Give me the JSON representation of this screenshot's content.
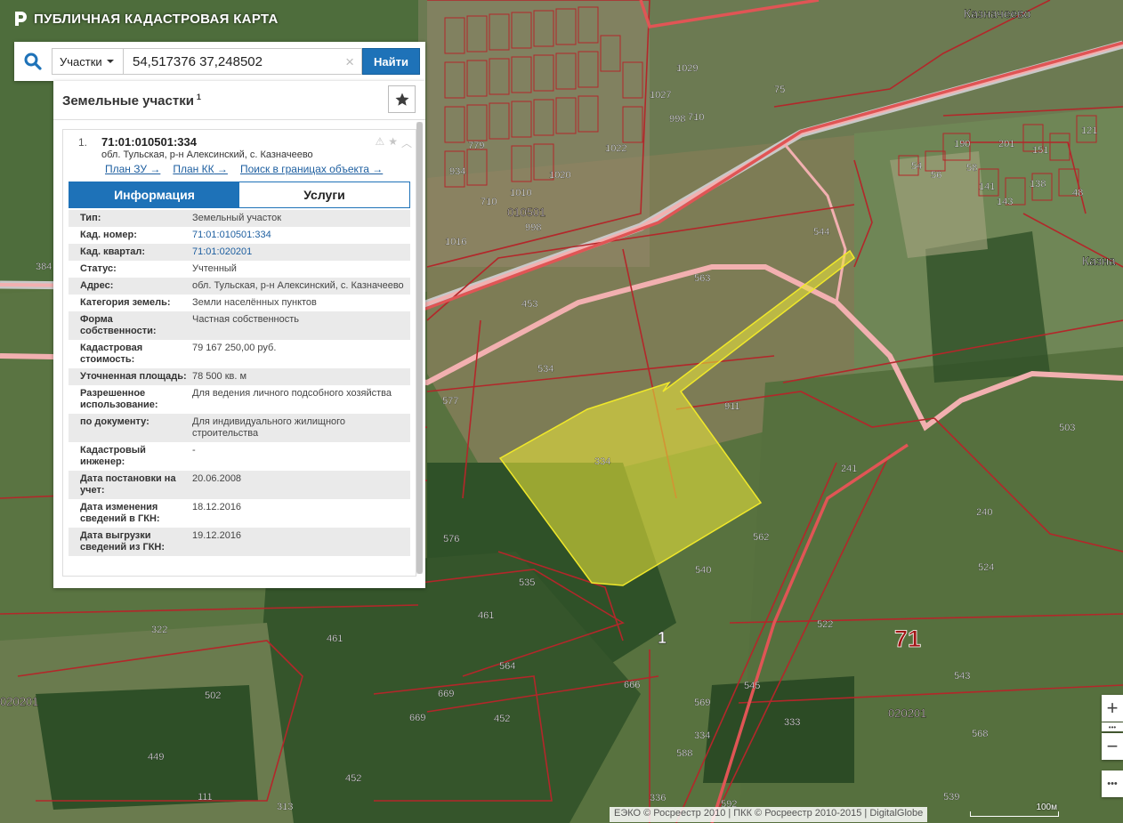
{
  "app": {
    "title": "ПУБЛИЧНАЯ КАДАСТРОВАЯ КАРТА"
  },
  "search": {
    "type_label": "Участки",
    "query": "54,517376 37,248502",
    "find_label": "Найти"
  },
  "panel": {
    "title": "Земельные участки",
    "count": "1",
    "item": {
      "index": "1.",
      "code": "71:01:010501:334",
      "address": "обл. Тульская, р-н Алексинский, с. Казначеево",
      "links": [
        "План ЗУ",
        "План КК",
        "Поиск в границах объекта"
      ],
      "tabs": [
        "Информация",
        "Услуги"
      ],
      "properties": [
        {
          "k": "Тип:",
          "v": "Земельный участок"
        },
        {
          "k": "Кад. номер:",
          "v": "71:01:010501:334",
          "link": true
        },
        {
          "k": "Кад. квартал:",
          "v": "71:01:020201",
          "link": true
        },
        {
          "k": "Статус:",
          "v": "Учтенный"
        },
        {
          "k": "Адрес:",
          "v": "обл. Тульская, р-н Алексинский, с. Казначеево"
        },
        {
          "k": "Категория земель:",
          "v": "Земли населённых пунктов"
        },
        {
          "k": "Форма собственности:",
          "v": "Частная собственность"
        },
        {
          "k": "Кадастровая стоимость:",
          "v": "79 167 250,00 руб."
        },
        {
          "k": "Уточненная площадь:",
          "v": "78 500 кв. м"
        },
        {
          "k": "Разрешенное использование:",
          "v": "Для ведения личного подсобного хозяйства"
        },
        {
          "k": "по документу:",
          "v": "Для индивидуального жилищного строительства"
        },
        {
          "k": "Кадастровый инженер:",
          "v": "-"
        },
        {
          "k": "Дата постановки на учет:",
          "v": "20.06.2008"
        },
        {
          "k": "Дата изменения сведений в ГКН:",
          "v": "18.12.2016"
        },
        {
          "k": "Дата выгрузки сведений из ГКН:",
          "v": "19.12.2016"
        }
      ]
    }
  },
  "map": {
    "places": [
      "Казначеево",
      "Казна"
    ],
    "big_labels": [
      "71",
      "1"
    ],
    "quarter_labels": [
      "010501",
      "020201",
      "020201"
    ],
    "parcel_labels": [
      "544",
      "563",
      "453",
      "534",
      "577",
      "911",
      "503",
      "240",
      "524",
      "562",
      "540",
      "522",
      "543",
      "545",
      "576",
      "535",
      "461",
      "564",
      "666",
      "669",
      "452",
      "449",
      "502",
      "322",
      "461",
      "111",
      "152",
      "313",
      "336",
      "452",
      "588",
      "569",
      "333",
      "334",
      "592",
      "568",
      "539",
      "241",
      "998",
      "1010",
      "1020",
      "1022",
      "1027",
      "1029",
      "710",
      "998",
      "384",
      "75",
      "190",
      "201",
      "151",
      "54",
      "56",
      "58",
      "148",
      "141",
      "143",
      "138",
      "48",
      "121",
      "334"
    ],
    "highlighted_parcel": "334",
    "colors": {
      "parcel_border": "#b3272a",
      "road": "#f3b3b3",
      "highlight": "#e8e33a"
    }
  },
  "controls": {
    "zoom_in": "+",
    "zoom_out": "−",
    "more": "•••"
  },
  "attribution": "ЕЭКО © Росреестр 2010 | ПКК © Росреестр 2010-2015 | DigitalGlobe",
  "scale": "100м"
}
